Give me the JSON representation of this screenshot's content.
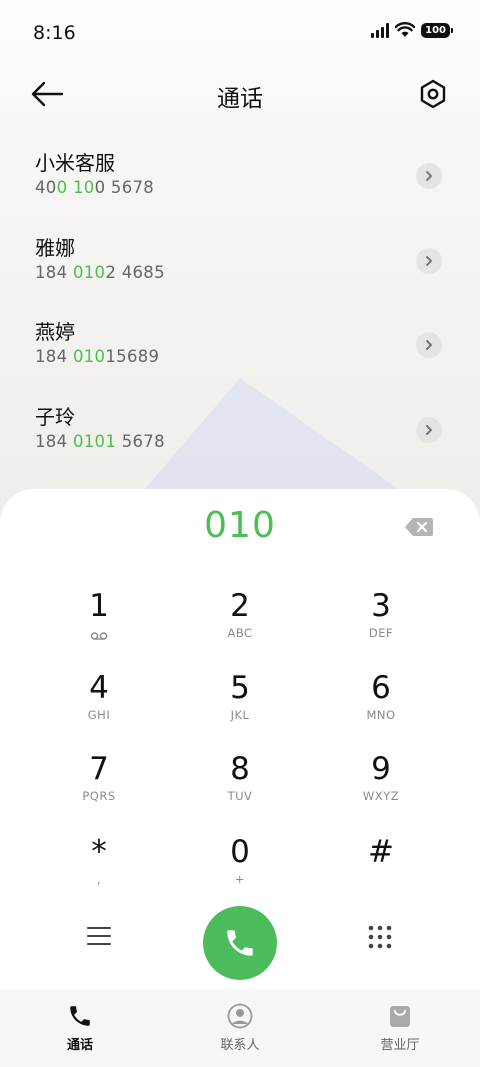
{
  "status_bar": {
    "time": "8:16",
    "battery": "100"
  },
  "header": {
    "title": "通话"
  },
  "contacts": [
    {
      "name": "小米客服",
      "number_parts": [
        "40",
        "0 10",
        "0 5678"
      ]
    },
    {
      "name": "雅娜",
      "number_parts": [
        "184 ",
        "010",
        "2 4685"
      ]
    },
    {
      "name": "燕婷",
      "number_parts": [
        "184 ",
        "010",
        "15689"
      ]
    },
    {
      "name": "子玲",
      "number_parts": [
        "184 ",
        "0101",
        " 5678"
      ]
    }
  ],
  "dialer": {
    "dialed": "010",
    "keys": [
      {
        "digit": "1",
        "letters": ""
      },
      {
        "digit": "2",
        "letters": "ABC"
      },
      {
        "digit": "3",
        "letters": "DEF"
      },
      {
        "digit": "4",
        "letters": "GHI"
      },
      {
        "digit": "5",
        "letters": "JKL"
      },
      {
        "digit": "6",
        "letters": "MNO"
      },
      {
        "digit": "7",
        "letters": "PQRS"
      },
      {
        "digit": "8",
        "letters": "TUV"
      },
      {
        "digit": "9",
        "letters": "WXYZ"
      },
      {
        "digit": "*",
        "letters": ","
      },
      {
        "digit": "0",
        "letters": "+"
      },
      {
        "digit": "#",
        "letters": ""
      }
    ]
  },
  "bottom_nav": [
    {
      "label": "通话",
      "icon": "phone-icon",
      "active": true
    },
    {
      "label": "联系人",
      "icon": "person-icon",
      "active": false
    },
    {
      "label": "营业厅",
      "icon": "shopping-bag-icon",
      "active": false
    }
  ],
  "colors": {
    "accent": "#4cbf54",
    "call_button": "#4cbb5c"
  }
}
